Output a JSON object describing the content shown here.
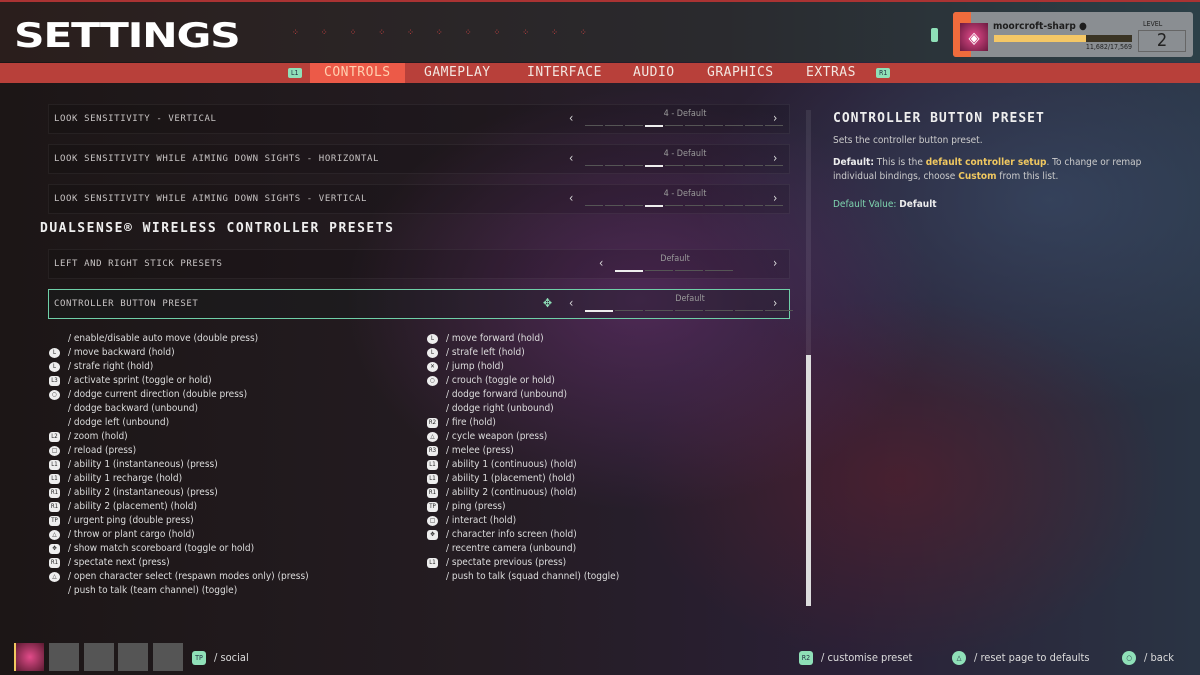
{
  "header": {
    "title": "SETTINGS",
    "battery_icon": "battery-icon"
  },
  "tabs": {
    "prev_bumper": "L1",
    "next_bumper": "R1",
    "items": [
      "CONTROLS",
      "GAMEPLAY",
      "INTERFACE",
      "AUDIO",
      "GRAPHICS",
      "EXTRAS"
    ],
    "active": "CONTROLS"
  },
  "profile": {
    "username": "moorcroft-sharp",
    "platform_icon": "playstation-icon",
    "xp": "11,682/17,569",
    "xp_fraction": 0.665,
    "level_label": "LEVEL",
    "level": "2"
  },
  "settings": {
    "rows": [
      {
        "label": "LOOK SENSITIVITY - VERTICAL",
        "value": "4 - Default"
      },
      {
        "label": "LOOK SENSITIVITY WHILE AIMING DOWN SIGHTS - HORIZONTAL",
        "value": "4 - Default"
      },
      {
        "label": "LOOK SENSITIVITY WHILE AIMING DOWN SIGHTS - VERTICAL",
        "value": "4 - Default"
      }
    ],
    "section_heading": "DUALSENSE® WIRELESS CONTROLLER PRESETS",
    "preset_rows": [
      {
        "label": "LEFT AND RIGHT STICK PRESETS",
        "value": "Default"
      },
      {
        "label": "CONTROLLER BUTTON PRESET",
        "value": "Default",
        "selected": true
      }
    ]
  },
  "bindings_left": [
    {
      "icon": "",
      "text": "/ enable/disable auto move (double press)"
    },
    {
      "icon": "L",
      "text": "/ move backward (hold)"
    },
    {
      "icon": "L",
      "text": "/ strafe right (hold)"
    },
    {
      "icon": "L3",
      "text": "/ activate sprint (toggle or hold)"
    },
    {
      "icon": "○",
      "text": "/ dodge current direction (double press)"
    },
    {
      "icon": "",
      "text": "/ dodge backward (unbound)"
    },
    {
      "icon": "",
      "text": "/ dodge left (unbound)"
    },
    {
      "icon": "L2",
      "text": "/ zoom (hold)"
    },
    {
      "icon": "□",
      "text": "/ reload (press)"
    },
    {
      "icon": "L1",
      "text": "/ ability 1 (instantaneous) (press)"
    },
    {
      "icon": "L1",
      "text": "/ ability 1 recharge (hold)"
    },
    {
      "icon": "R1",
      "text": "/ ability 2 (instantaneous) (press)"
    },
    {
      "icon": "R1",
      "text": "/ ability 2 (placement) (hold)"
    },
    {
      "icon": "TP",
      "text": "/ urgent ping (double press)"
    },
    {
      "icon": "△",
      "text": "/ throw or plant cargo (hold)"
    },
    {
      "icon": "✥",
      "text": "/ show match scoreboard (toggle or hold)"
    },
    {
      "icon": "R1",
      "text": "/ spectate next (press)"
    },
    {
      "icon": "△",
      "text": "/ open character select (respawn modes only) (press)"
    },
    {
      "icon": "",
      "text": "/ push to talk (team channel) (toggle)"
    }
  ],
  "bindings_right": [
    {
      "icon": "L",
      "text": "/ move forward (hold)"
    },
    {
      "icon": "L",
      "text": "/ strafe left (hold)"
    },
    {
      "icon": "✕",
      "text": "/ jump (hold)"
    },
    {
      "icon": "○",
      "text": "/ crouch (toggle or hold)"
    },
    {
      "icon": "",
      "text": "/ dodge forward (unbound)"
    },
    {
      "icon": "",
      "text": "/ dodge right (unbound)"
    },
    {
      "icon": "R2",
      "text": "/ fire (hold)"
    },
    {
      "icon": "△",
      "text": "/ cycle weapon (press)"
    },
    {
      "icon": "R3",
      "text": "/ melee (press)"
    },
    {
      "icon": "L1",
      "text": "/ ability 1 (continuous) (hold)"
    },
    {
      "icon": "L1",
      "text": "/ ability 1 (placement) (hold)"
    },
    {
      "icon": "R1",
      "text": "/ ability 2 (continuous) (hold)"
    },
    {
      "icon": "TP",
      "text": "/ ping (press)"
    },
    {
      "icon": "□",
      "text": "/ interact (hold)"
    },
    {
      "icon": "✥",
      "text": "/ character info screen (hold)"
    },
    {
      "icon": "",
      "text": "/ recentre camera (unbound)"
    },
    {
      "icon": "L1",
      "text": "/ spectate previous (press)"
    },
    {
      "icon": "",
      "text": "/ push to talk (squad channel) (toggle)"
    }
  ],
  "help": {
    "title": "CONTROLLER BUTTON PRESET",
    "description": "Sets the controller button preset.",
    "default_label": "Default:",
    "p1": " This is the ",
    "hl1": "default controller setup",
    "p2": ". To change or remap individual bindings, choose ",
    "hl2": "Custom",
    "p3": " from this list.",
    "default_value_label": "Default Value:",
    "default_value": "Default"
  },
  "footer": {
    "social_icon": "TP",
    "social": "/ social",
    "customise_icon": "R2",
    "customise": "/ customise preset",
    "reset_icon": "△",
    "reset": "/ reset page to defaults",
    "back_icon": "○",
    "back": "/ back"
  },
  "colors": {
    "accent_red": "#b8403a",
    "active_tab": "#ec5a48",
    "accent_green": "#8fe0b8",
    "highlight_yellow": "#f0c860"
  }
}
